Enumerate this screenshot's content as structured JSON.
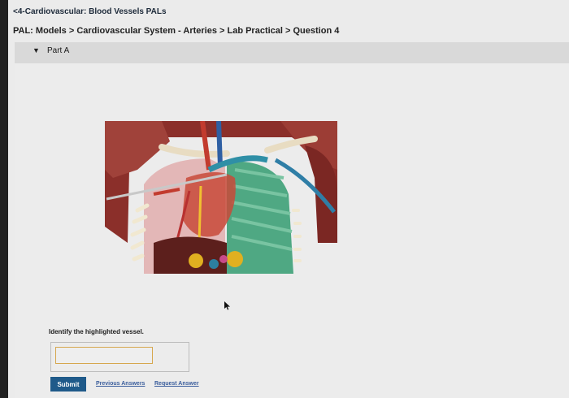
{
  "header": {
    "back_link": "<4-Cardiovascular: Blood Vessels PALs",
    "breadcrumb": "PAL: Models > Cardiovascular System - Arteries > Lab Practical > Question 4"
  },
  "part": {
    "label": "Part A",
    "caret_icon": "triangle-down-icon"
  },
  "question": {
    "prompt": "Identify the highlighted vessel.",
    "answer_value": "",
    "answer_placeholder": ""
  },
  "actions": {
    "submit_label": "Submit",
    "previous_answers_label": "Previous Answers",
    "request_answer_label": "Request Answer"
  },
  "image": {
    "subject": "anatomical-torso-model",
    "highlight_color": "#3fa38a"
  },
  "colors": {
    "submit_bg": "#1f5a8a",
    "link": "#3a5d9c",
    "input_border": "#d6a74e"
  }
}
